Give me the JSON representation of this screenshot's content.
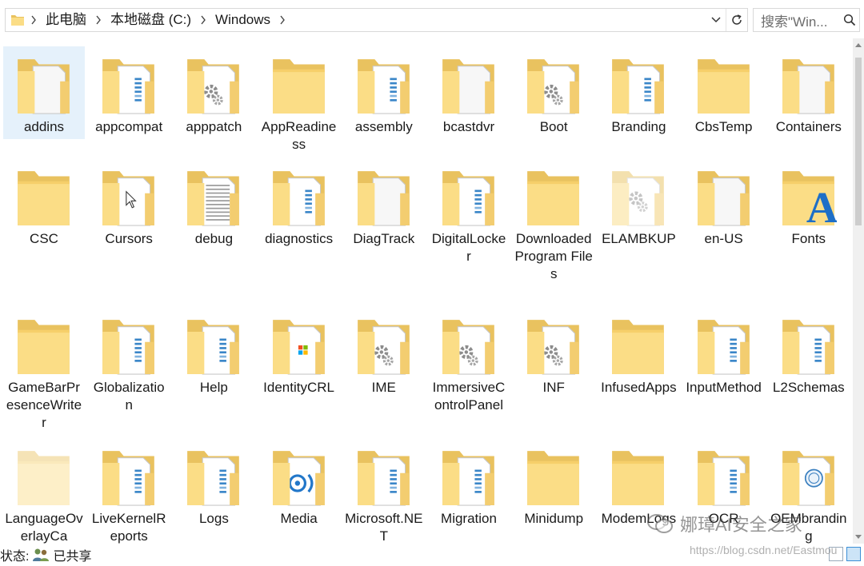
{
  "address_bar": {
    "breadcrumbs": [
      "此电脑",
      "本地磁盘 (C:)",
      "Windows"
    ]
  },
  "search": {
    "placeholder": "搜索\"Win..."
  },
  "items": [
    {
      "label": "addins",
      "icon": "folder-blank-doc",
      "selected": true
    },
    {
      "label": "appcompat",
      "icon": "folder-blue-doc"
    },
    {
      "label": "apppatch",
      "icon": "folder-gear-doc"
    },
    {
      "label": "AppReadiness",
      "icon": "folder"
    },
    {
      "label": "assembly",
      "icon": "folder-blue-doc"
    },
    {
      "label": "bcastdvr",
      "icon": "folder-blank-doc"
    },
    {
      "label": "Boot",
      "icon": "folder-gear-doc"
    },
    {
      "label": "Branding",
      "icon": "folder-blue-doc"
    },
    {
      "label": "CbsTemp",
      "icon": "folder"
    },
    {
      "label": "Containers",
      "icon": "folder-blank-doc"
    },
    {
      "label": "CSC",
      "icon": "folder"
    },
    {
      "label": "Cursors",
      "icon": "folder-cursor-doc"
    },
    {
      "label": "debug",
      "icon": "folder-text-doc"
    },
    {
      "label": "diagnostics",
      "icon": "folder-blue-doc"
    },
    {
      "label": "DiagTrack",
      "icon": "folder-blank-doc"
    },
    {
      "label": "DigitalLocker",
      "icon": "folder-blue-doc"
    },
    {
      "label": "Downloaded Program Files",
      "icon": "folder"
    },
    {
      "label": "ELAMBKUP",
      "icon": "folder-faded-gear"
    },
    {
      "label": "en-US",
      "icon": "folder-blank-doc"
    },
    {
      "label": "Fonts",
      "icon": "folder-font"
    },
    {
      "label": "GameBarPresenceWriter",
      "icon": "folder"
    },
    {
      "label": "Globalization",
      "icon": "folder-blue-doc"
    },
    {
      "label": "Help",
      "icon": "folder-blue-doc"
    },
    {
      "label": "IdentityCRL",
      "icon": "folder-windows-doc"
    },
    {
      "label": "IME",
      "icon": "folder-gear-doc"
    },
    {
      "label": "ImmersiveControlPanel",
      "icon": "folder-gear-doc"
    },
    {
      "label": "INF",
      "icon": "folder-gear-doc"
    },
    {
      "label": "InfusedApps",
      "icon": "folder"
    },
    {
      "label": "InputMethod",
      "icon": "folder-blue-doc"
    },
    {
      "label": "L2Schemas",
      "icon": "folder-blue-doc"
    },
    {
      "label": "LanguageOverlayCa",
      "icon": "folder-faded"
    },
    {
      "label": "LiveKernelReports",
      "icon": "folder-blue-doc"
    },
    {
      "label": "Logs",
      "icon": "folder-blue-doc"
    },
    {
      "label": "Media",
      "icon": "folder-media"
    },
    {
      "label": "Microsoft.NET",
      "icon": "folder-blue-doc"
    },
    {
      "label": "Migration",
      "icon": "folder-blue-doc"
    },
    {
      "label": "Minidump",
      "icon": "folder"
    },
    {
      "label": "ModemLogs",
      "icon": "folder"
    },
    {
      "label": "OCR",
      "icon": "folder-blue-doc"
    },
    {
      "label": "OEMbranding",
      "icon": "folder-seal-doc"
    }
  ],
  "status_bar": {
    "state_label": "状态:",
    "shared_label": "已共享"
  },
  "watermark": {
    "text": "娜璋AI安全之家",
    "url": "https://blog.csdn.net/Eastmou"
  },
  "colors": {
    "folder_back": "#e9c25f",
    "folder_front": "#fbdd86",
    "selection": "#e5f1fb",
    "doc_blue": "#3a86c8"
  }
}
